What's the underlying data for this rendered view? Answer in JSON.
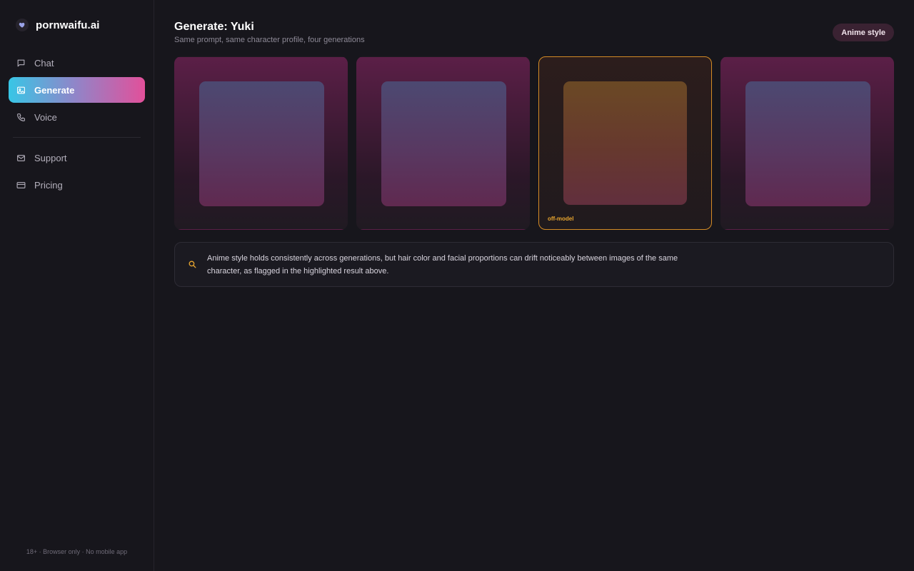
{
  "brand": {
    "name": "pornwaifu.ai",
    "icon": "heart-icon",
    "icon_color": "#9aa3e8"
  },
  "sidebar": {
    "primary": [
      {
        "label": "Chat",
        "icon": "chat-bubble-icon",
        "active": false
      },
      {
        "label": "Generate",
        "icon": "image-icon",
        "active": true
      },
      {
        "label": "Voice",
        "icon": "phone-icon",
        "active": false
      }
    ],
    "secondary": [
      {
        "label": "Support",
        "icon": "mail-icon"
      },
      {
        "label": "Pricing",
        "icon": "credit-card-icon"
      }
    ],
    "footer": "18+ · Browser only · No mobile app"
  },
  "header": {
    "title": "Generate: Yuki",
    "subtitle": "Same prompt, same character profile, four generations",
    "style_badge": "Anime style"
  },
  "generations": [
    {
      "flagged": false,
      "label": ""
    },
    {
      "flagged": false,
      "label": ""
    },
    {
      "flagged": true,
      "label": "off-model"
    },
    {
      "flagged": false,
      "label": ""
    }
  ],
  "insight": {
    "icon": "search-icon",
    "text": "Anime style holds consistently across generations, but hair color and facial proportions can drift noticeably between images of the same character, as flagged in the highlighted result above."
  },
  "colors": {
    "accent_gradient_start": "#38c6e6",
    "accent_gradient_end": "#e2509a",
    "flag": "#d48b25",
    "background": "#17161c"
  }
}
